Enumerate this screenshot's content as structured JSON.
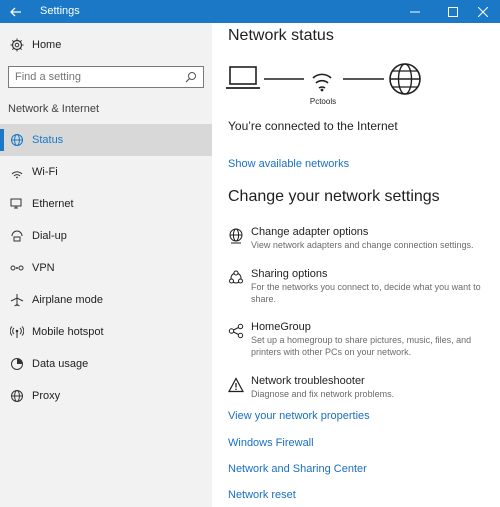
{
  "window": {
    "title": "Settings"
  },
  "sidebar": {
    "home_label": "Home",
    "search_placeholder": "Find a setting",
    "section_label": "Network & Internet",
    "items": [
      {
        "label": "Status",
        "icon": "globe-status-icon",
        "active": true
      },
      {
        "label": "Wi-Fi",
        "icon": "wifi-icon"
      },
      {
        "label": "Ethernet",
        "icon": "ethernet-icon"
      },
      {
        "label": "Dial-up",
        "icon": "dialup-icon"
      },
      {
        "label": "VPN",
        "icon": "vpn-icon"
      },
      {
        "label": "Airplane mode",
        "icon": "airplane-icon"
      },
      {
        "label": "Mobile hotspot",
        "icon": "hotspot-icon"
      },
      {
        "label": "Data usage",
        "icon": "data-usage-icon"
      },
      {
        "label": "Proxy",
        "icon": "globe-icon"
      }
    ]
  },
  "main": {
    "status_heading": "Network status",
    "network_name": "Pctools",
    "connected_text": "You’re connected to the Internet",
    "show_networks_link": "Show available networks",
    "change_heading": "Change your network settings",
    "options": [
      {
        "title": "Change adapter options",
        "desc": "View network adapters and change connection settings.",
        "icon": "adapter-icon"
      },
      {
        "title": "Sharing options",
        "desc": "For the networks you connect to, decide what you want to share.",
        "icon": "sharing-icon"
      },
      {
        "title": "HomeGroup",
        "desc": "Set up a homegroup to share pictures, music, files, and printers with other PCs on your network.",
        "icon": "homegroup-icon"
      },
      {
        "title": "Network troubleshooter",
        "desc": "Diagnose and fix network problems.",
        "icon": "warning-icon"
      }
    ],
    "links": [
      "View your network properties",
      "Windows Firewall",
      "Network and Sharing Center",
      "Network reset"
    ]
  },
  "colors": {
    "accent": "#1a78c7",
    "link": "#1a6fc3",
    "sidebar_bg": "#f2f2f2",
    "active_bg": "#d8d8d8"
  }
}
